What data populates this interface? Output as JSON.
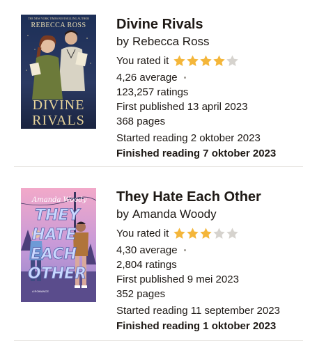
{
  "colors": {
    "star_filled": "#f4b63a",
    "star_empty": "#d6d3ce",
    "text": "#1e1915",
    "divider": "#e4e1dc"
  },
  "books": [
    {
      "title": "Divine Rivals",
      "by_label": "by",
      "author": "Rebecca Ross",
      "rated_label": "You rated it",
      "rating_stars": 4,
      "average": "4,26 average",
      "ratings_count": "123,257 ratings",
      "first_published": "First published 13 april 2023",
      "pages": "368 pages",
      "started_reading": "Started reading 2 oktober 2023",
      "finished_reading": "Finished reading 7 oktober 2023",
      "cover": {
        "top_text": "THE NEW YORK TIMES BESTSELLING AUTHOR",
        "author_line": "REBECCA ROSS",
        "title_line_1": "DIVINE",
        "title_line_2": "RIVALS"
      }
    },
    {
      "title": "They Hate Each Other",
      "by_label": "by",
      "author": "Amanda Woody",
      "rated_label": "You rated it",
      "rating_stars": 3,
      "average": "4,30 average",
      "ratings_count": "2,804 ratings",
      "first_published": "First published 9 mei 2023",
      "pages": "352 pages",
      "started_reading": "Started reading 11 september 2023",
      "finished_reading": "Finished reading 1 oktober 2023",
      "cover": {
        "author_line": "Amanda Woody",
        "title_line_1": "THEY",
        "title_line_2": "HATE",
        "title_line_3": "EACH",
        "title_line_4": "OTHER",
        "tagline": "A ROMANCE"
      }
    }
  ]
}
